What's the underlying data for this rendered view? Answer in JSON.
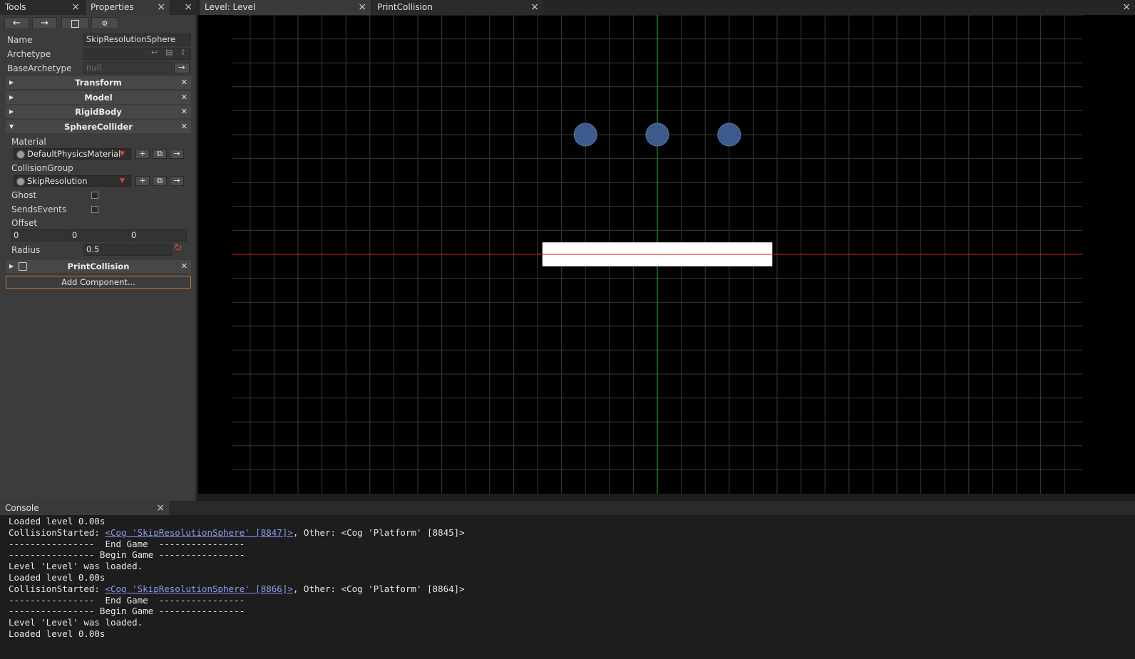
{
  "tabs": {
    "tools": "Tools",
    "properties": "Properties",
    "level": "Level: Level",
    "print_collision": "PrintCollision",
    "console": "Console",
    "close": "×"
  },
  "properties": {
    "name_label": "Name",
    "name_value": "SkipResolutionSphere",
    "archetype_label": "Archetype",
    "archetype_value": "",
    "base_archetype_label": "BaseArchetype",
    "base_archetype_value": "null",
    "sections": {
      "transform": "Transform",
      "model": "Model",
      "rigidbody": "RigidBody",
      "sphere_collider": "SphereCollider",
      "print_collision": "PrintCollision"
    },
    "material_label": "Material",
    "material_value": "DefaultPhysicsMaterial",
    "collision_group_label": "CollisionGroup",
    "collision_group_value": "SkipResolution",
    "ghost_label": "Ghost",
    "ghost_checked": false,
    "sends_events_label": "SendsEvents",
    "sends_events_checked": false,
    "offset_label": "Offset",
    "offset": [
      "0",
      "0",
      "0"
    ],
    "radius_label": "Radius",
    "radius_value": "0.5",
    "add_component": "Add Component..."
  },
  "viewport": {
    "spheres": [
      {
        "x": -1.5,
        "y": 2.5
      },
      {
        "x": 0,
        "y": 2.5
      },
      {
        "x": 1.5,
        "y": 2.5
      }
    ],
    "platform": {
      "x": 0,
      "y": 0,
      "width": 4.8,
      "height": 0.5
    },
    "colors": {
      "x_axis": "#d11f1f",
      "y_axis": "#1fbf1f",
      "grid": "#3a3a3a",
      "sphere": "#3c5b8c"
    }
  },
  "console": {
    "lines": [
      {
        "text": "Loaded level 0.00s"
      },
      {
        "prefix": "CollisionStarted: ",
        "link": "<Cog 'SkipResolutionSphere' [8847]>",
        "suffix": ", Other: <Cog 'Platform' [8845]>"
      },
      {
        "text": "----------------  End Game  ----------------"
      },
      {
        "text": "---------------- Begin Game ----------------"
      },
      {
        "text": "Level 'Level' was loaded."
      },
      {
        "text": "Loaded level 0.00s"
      },
      {
        "prefix": "CollisionStarted: ",
        "link": "<Cog 'SkipResolutionSphere' [8866]>",
        "suffix": ", Other: <Cog 'Platform' [8864]>"
      },
      {
        "text": "----------------  End Game  ----------------"
      },
      {
        "text": "---------------- Begin Game ----------------"
      },
      {
        "text": "Level 'Level' was loaded."
      },
      {
        "text": "Loaded level 0.00s"
      }
    ]
  }
}
